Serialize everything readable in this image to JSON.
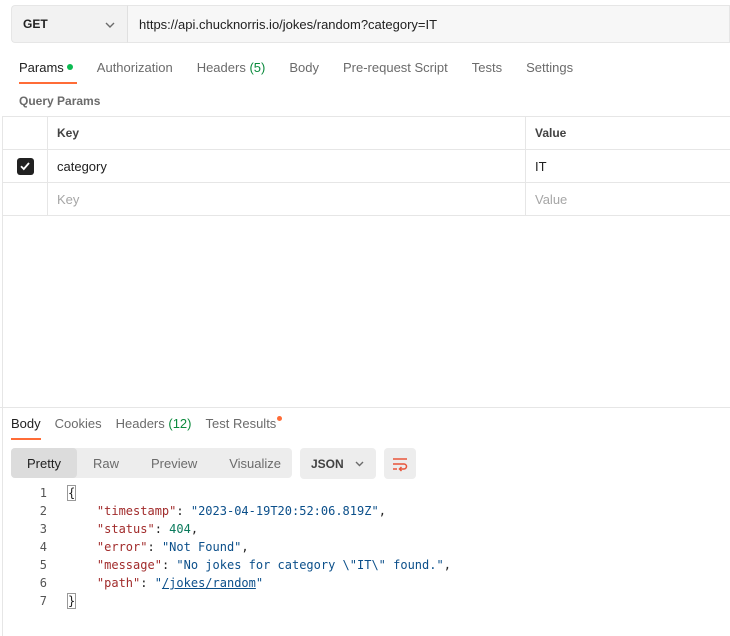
{
  "request": {
    "method": "GET",
    "url": "https://api.chucknorris.io/jokes/random?category=IT"
  },
  "request_tabs": {
    "params": "Params",
    "authorization": "Authorization",
    "headers": "Headers",
    "headers_count": "(5)",
    "body": "Body",
    "prerequest": "Pre-request Script",
    "tests": "Tests",
    "settings": "Settings"
  },
  "query_params": {
    "title": "Query Params",
    "col_key": "Key",
    "col_value": "Value",
    "rows": [
      {
        "key": "category",
        "value": "IT",
        "checked": true
      }
    ],
    "placeholder_key": "Key",
    "placeholder_value": "Value"
  },
  "response_tabs": {
    "body": "Body",
    "cookies": "Cookies",
    "headers": "Headers",
    "headers_count": "(12)",
    "test_results": "Test Results"
  },
  "view": {
    "modes": [
      "Pretty",
      "Raw",
      "Preview",
      "Visualize"
    ],
    "active": "Pretty",
    "format": "JSON"
  },
  "response_body": {
    "line_numbers": [
      "1",
      "2",
      "3",
      "4",
      "5",
      "6",
      "7"
    ],
    "open_brace": "{",
    "close_brace": "}",
    "timestamp_key": "\"timestamp\"",
    "timestamp_val": "\"2023-04-19T20:52:06.819Z\"",
    "status_key": "\"status\"",
    "status_val": "404",
    "error_key": "\"error\"",
    "error_val": "\"Not Found\"",
    "message_key": "\"message\"",
    "message_val": "\"No jokes for category \\\"IT\\\" found.\"",
    "path_key": "\"path\"",
    "path_q1": "\"",
    "path_val": "/jokes/random",
    "path_q2": "\""
  },
  "colors": {
    "accent": "#ff6c37",
    "green": "#0cbb52"
  }
}
